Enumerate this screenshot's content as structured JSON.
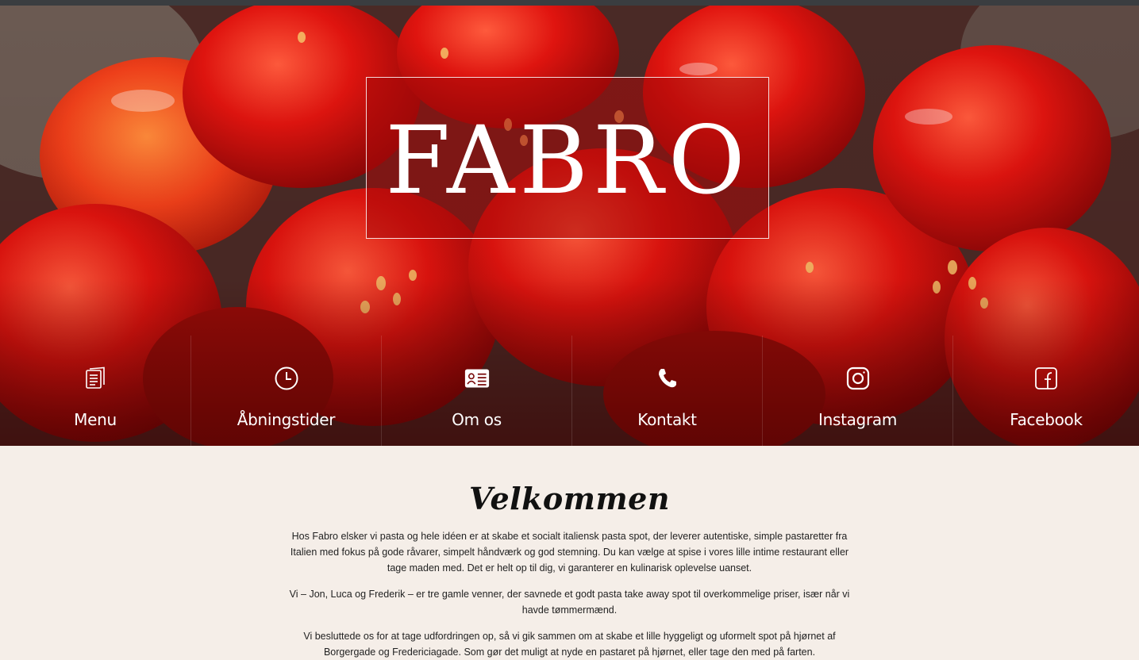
{
  "brand": {
    "name": "FABRO",
    "colors": {
      "accent": "#c0120e",
      "background": "#f5eee8",
      "topbar": "#3a3d40"
    }
  },
  "nav": {
    "items": [
      {
        "label": "Menu",
        "icon": "menu-card-icon"
      },
      {
        "label": "Åbningstider",
        "icon": "clock-icon"
      },
      {
        "label": "Om os",
        "icon": "contact-card-icon"
      },
      {
        "label": "Kontakt",
        "icon": "phone-icon"
      },
      {
        "label": "Instagram",
        "icon": "instagram-icon"
      },
      {
        "label": "Facebook",
        "icon": "facebook-icon"
      }
    ]
  },
  "content": {
    "heading": "Velkommen",
    "paragraphs": [
      "Hos Fabro elsker vi pasta og hele idéen er at skabe et socialt italiensk pasta spot, der leverer autentiske, simple pastaretter fra Italien med fokus på gode råvarer, simpelt håndværk og god stemning. Du kan vælge at spise i vores lille intime restaurant eller tage maden med. Det er helt op til dig, vi garanterer en kulinarisk oplevelse uanset.",
      "Vi – Jon, Luca og Frederik – er tre gamle venner, der savnede et godt pasta take away spot til overkommelige priser, især når vi havde tømmermænd.",
      "Vi besluttede os for at tage udfordringen op, så vi gik sammen om at skabe et lille hyggeligt og uformelt spot på hjørnet af Borgergade og Fredericiagade. Som gør det muligt at nyde en pastaret på hjørnet, eller tage den med på farten."
    ]
  }
}
